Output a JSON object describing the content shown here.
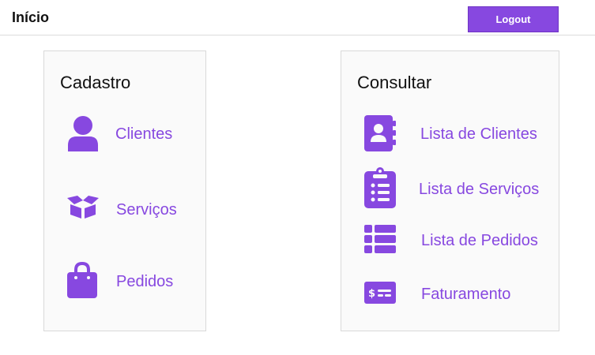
{
  "header": {
    "title": "Início",
    "logout_label": "Logout"
  },
  "cadastro": {
    "title": "Cadastro",
    "items": [
      {
        "label": "Clientes",
        "icon": "user-icon"
      },
      {
        "label": "Serviços",
        "icon": "open-box-icon"
      },
      {
        "label": "Pedidos",
        "icon": "shopping-bag-icon"
      }
    ]
  },
  "consultar": {
    "title": "Consultar",
    "items": [
      {
        "label": "Lista de Clientes",
        "icon": "address-book-icon"
      },
      {
        "label": "Lista de Serviços",
        "icon": "clipboard-list-icon"
      },
      {
        "label": "Lista de Pedidos",
        "icon": "table-list-icon"
      },
      {
        "label": "Faturamento",
        "icon": "money-check-icon"
      }
    ]
  },
  "colors": {
    "accent": "#8748e0",
    "card_background": "#fafafa",
    "card_border": "#d9d9d9"
  }
}
